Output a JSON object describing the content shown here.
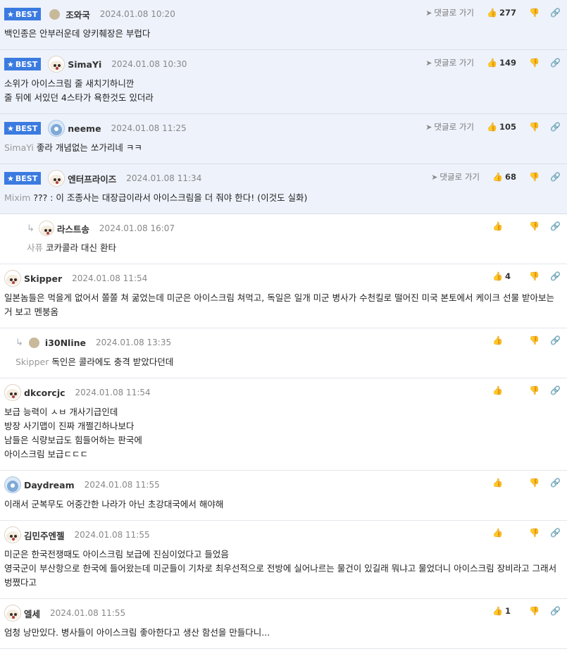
{
  "best_label": "BEST",
  "go_label": "댓글로 가기",
  "comments": [
    {
      "best": true,
      "avatar": "dot",
      "nick": "조와국",
      "date": "2024.01.08 10:20",
      "votes": "277",
      "mention": "",
      "text": "백인종은 안부러운데 양키췌장은 부럽다"
    },
    {
      "best": true,
      "avatar": "dog",
      "nick": "SimaYi",
      "date": "2024.01.08 10:30",
      "votes": "149",
      "mention": "",
      "text": "소위가 아이스크림 줄 새치기하니깐\n줄 뒤에 서있던 4스타가 욕한것도 있더라"
    },
    {
      "best": true,
      "avatar": "blue",
      "nick": "neeme",
      "date": "2024.01.08 11:25",
      "votes": "105",
      "mention": "SimaYi",
      "text": "좋라 개념없는 쏘가리네 ㅋㅋ"
    },
    {
      "best": true,
      "avatar": "dog",
      "nick": "엔터프라이즈",
      "date": "2024.01.08 11:34",
      "votes": "68",
      "mention": "Mixim",
      "text": "??? : 이 조종사는 대장급이라서 아이스크림을 더 줘야 한다! (이것도 실화)"
    },
    {
      "reply": true,
      "avatar": "dog",
      "nick": "라스트송",
      "date": "2024.01.08 16:07",
      "votes": "",
      "mention": "사퓨",
      "text": "코카콜라 대신 환타"
    },
    {
      "avatar": "dog",
      "nick": "Skipper",
      "date": "2024.01.08 11:54",
      "votes": "4",
      "mention": "",
      "text": "일본놈들은 먹을게 없어서 쫄쫄 쳐 굶었는데 미군은 아이스크림 쳐먹고, 독일은 일개 미군 병사가 수천킬로 떨어진 미국 본토에서 케이크 선물 받아보는거 보고 멘붕옴"
    },
    {
      "reply": true,
      "r2": true,
      "avatar": "dot",
      "nick": "i30Nline",
      "date": "2024.01.08 13:35",
      "votes": "",
      "mention": "Skipper",
      "text": "독인은 콜라에도 충격 받았다던데"
    },
    {
      "avatar": "dog",
      "nick": "dkcorcjc",
      "date": "2024.01.08 11:54",
      "votes": "",
      "mention": "",
      "text": "보급 능력이 ㅅㅂ 개사기급인데\n방장 사기맵이 진짜 개쩔긴하나보다\n남들은 식량보급도 힘들어하는 판국에\n아이스크림 보급ㄷㄷㄷ"
    },
    {
      "avatar": "blue",
      "nick": "Daydream",
      "date": "2024.01.08 11:55",
      "votes": "",
      "mention": "",
      "text": "이래서 군복무도 어중간한 나라가 아닌 초강대국에서 해야해"
    },
    {
      "avatar": "dog",
      "nick": "김민주엔젤",
      "date": "2024.01.08 11:55",
      "votes": "",
      "mention": "",
      "text": "미군은 한국전쟁때도 아이스크림 보급에 진심이었다고 들었음\n영국군이 부산항으로 한국에 들어왔는데 미군들이 기차로 최우선적으로 전방에 실어나르는 물건이 있길래 뭐냐고 물었더니 아이스크림 장비라고 그래서 벙쪘다고"
    },
    {
      "avatar": "dog",
      "nick": "엘세",
      "date": "2024.01.08 11:55",
      "votes": "1",
      "mention": "",
      "text": "엄청 낭만있다. 병사들이 아이스크림 좋아한다고 생산 함선을 만들다니..."
    }
  ]
}
